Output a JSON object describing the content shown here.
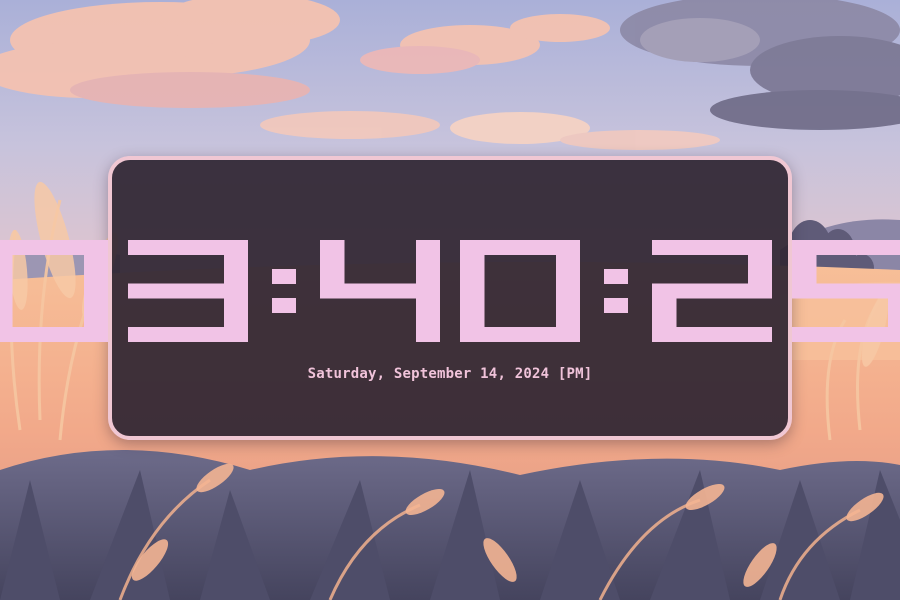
{
  "wallpaper": {
    "description_icon": "wheat-field-sunset-illustration",
    "colors": {
      "sky_top": "#b9bcd9",
      "sky_bottom": "#e4c3cc",
      "cloud": "#f2bfae",
      "field": "#f2b08e",
      "foliage": "#5a5a78"
    }
  },
  "clock": {
    "time": "03:40:25",
    "date": "Saturday, September 14, 2024",
    "period": "[PM]",
    "colors": {
      "digit": "#f1c3e6",
      "panel": "#2f2633",
      "border": "#f0c7d3",
      "date_text": "#f0c3da"
    }
  }
}
